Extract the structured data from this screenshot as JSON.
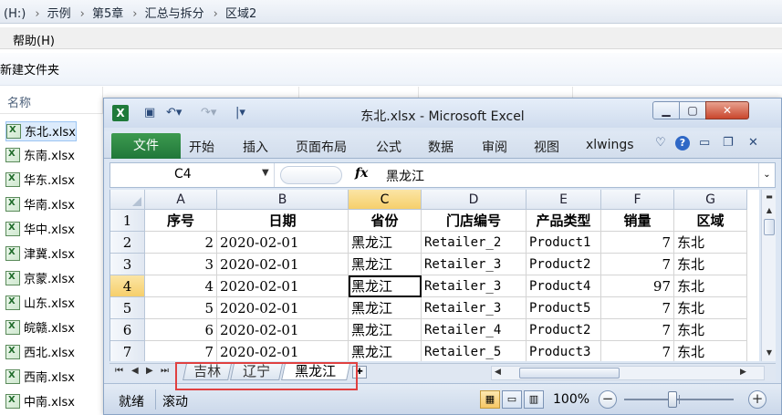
{
  "explorer": {
    "breadcrumbs": [
      "(H:)",
      "示例",
      "第5章",
      "汇总与拆分",
      "区域2"
    ],
    "menu_help": "帮助(H)",
    "new_folder": "新建文件夹",
    "col_name": "名称",
    "files": [
      "东北.xlsx",
      "东南.xlsx",
      "华东.xlsx",
      "华南.xlsx",
      "华中.xlsx",
      "津冀.xlsx",
      "京蒙.xlsx",
      "山东.xlsx",
      "皖赣.xlsx",
      "西北.xlsx",
      "西南.xlsx",
      "中南.xlsx"
    ],
    "selected_file": "东北.xlsx"
  },
  "excel": {
    "title": "东北.xlsx - Microsoft Excel",
    "app_icon": "X",
    "tabs": {
      "file": "文件",
      "home": "开始",
      "insert": "插入",
      "layout": "页面布局",
      "formula": "公式",
      "data": "数据",
      "review": "审阅",
      "view": "视图",
      "xlwings": "xlwings"
    },
    "name_box": "C4",
    "fx": "fx",
    "formula_value": "黑龙江",
    "columns": [
      "A",
      "B",
      "C",
      "D",
      "E",
      "F",
      "G"
    ],
    "active_column": "C",
    "active_row": "4",
    "rows": [
      {
        "n": "1",
        "cells": [
          "序号",
          "日期",
          "省份",
          "门店编号",
          "产品类型",
          "销量",
          "区域"
        ]
      },
      {
        "n": "2",
        "cells": [
          "2",
          "2020-02-01",
          "黑龙江",
          "Retailer_2",
          "Product1",
          "7",
          "东北"
        ]
      },
      {
        "n": "3",
        "cells": [
          "3",
          "2020-02-01",
          "黑龙江",
          "Retailer_3",
          "Product2",
          "7",
          "东北"
        ]
      },
      {
        "n": "4",
        "cells": [
          "4",
          "2020-02-01",
          "黑龙江",
          "Retailer_3",
          "Product4",
          "97",
          "东北"
        ]
      },
      {
        "n": "5",
        "cells": [
          "5",
          "2020-02-01",
          "黑龙江",
          "Retailer_3",
          "Product5",
          "7",
          "东北"
        ]
      },
      {
        "n": "6",
        "cells": [
          "6",
          "2020-02-01",
          "黑龙江",
          "Retailer_4",
          "Product2",
          "7",
          "东北"
        ]
      },
      {
        "n": "7",
        "cells": [
          "7",
          "2020-02-01",
          "黑龙江",
          "Retailer_5",
          "Product3",
          "7",
          "东北"
        ]
      }
    ],
    "sheets": [
      "吉林",
      "辽宁",
      "黑龙江"
    ],
    "active_sheet": "黑龙江",
    "status_ready": "就绪",
    "status_scroll": "滚动",
    "zoom": "100%",
    "zoom_minus": "−",
    "zoom_plus": "+",
    "highlight_color": "#e04040"
  }
}
